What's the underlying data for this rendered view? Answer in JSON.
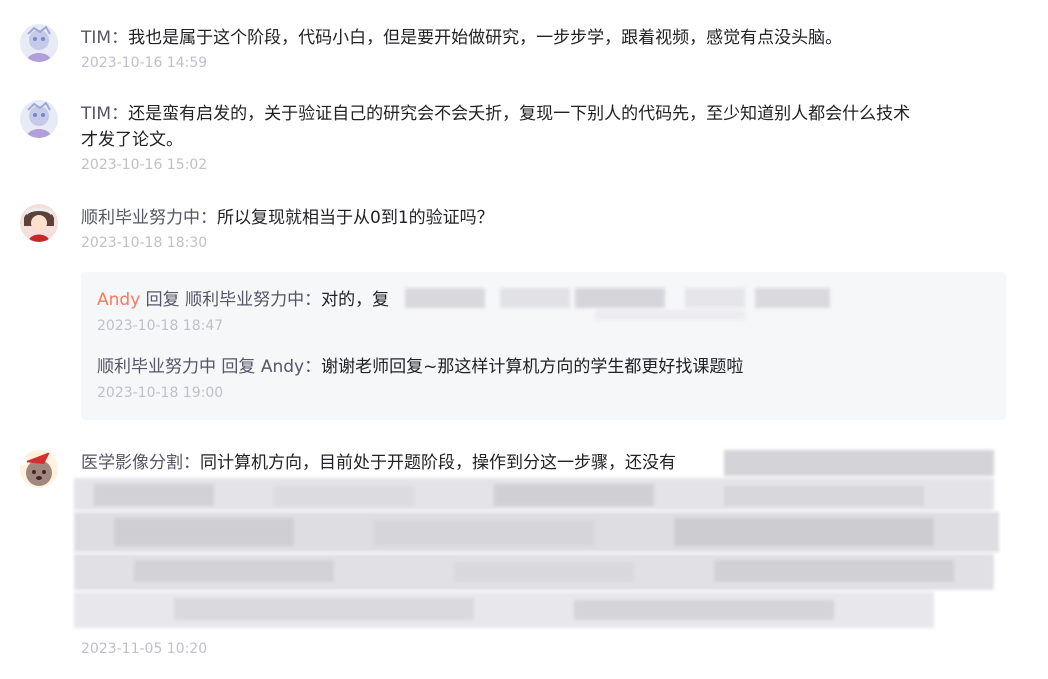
{
  "comments": [
    {
      "author": "TIM",
      "sep": "：",
      "text": "我也是属于这个阶段，代码小白，但是要开始做研究，一步步学，跟着视频，感觉有点没头脑。",
      "time": "2023-10-16 14:59"
    },
    {
      "author": "TIM",
      "sep": "：",
      "text": "还是蛮有启发的，关于验证自己的研究会不会夭折，复现一下别人的代码先，至少知道别人都会什么技术",
      "text2": "才发了论文。",
      "time": "2023-10-16 15:02"
    },
    {
      "author": "顺利毕业努力中",
      "sep": "：",
      "text": "所以复现就相当于从0到1的验证吗？",
      "time": "2023-10-18 18:30",
      "replies": [
        {
          "author": "Andy",
          "verb": "回复",
          "target": "顺利毕业努力中",
          "sep": "：",
          "text": "对的，复",
          "time": "2023-10-18 18:47"
        },
        {
          "author": "顺利毕业努力中",
          "verb": "回复",
          "target": "Andy",
          "sep": "：",
          "text": "谢谢老师回复~那这样计算机方向的学生都更好找课题啦",
          "time": "2023-10-18 19:00"
        }
      ]
    },
    {
      "author": "医学影像分割",
      "sep": "：",
      "text": "同计算机方向，目前处于开题阶段，操作到分这一步骤，还没有",
      "time": "2023-11-05 10:20"
    }
  ],
  "colors": {
    "author": "#555666",
    "reply_author_highlight": "#fc5531",
    "text": "#222226",
    "timestamp": "#c0c0c8",
    "reply_bg": "#f6f7f9"
  }
}
